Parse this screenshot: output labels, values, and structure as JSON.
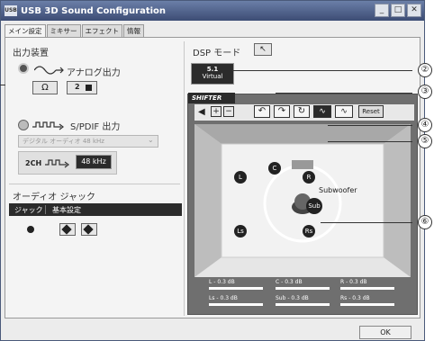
{
  "window": {
    "title": "USB 3D Sound Configuration",
    "app_icon": "USB"
  },
  "title_buttons": {
    "min": "_",
    "max": "□",
    "close": "✕"
  },
  "tabs": [
    {
      "label": "メイン設定"
    },
    {
      "label": "ミキサー"
    },
    {
      "label": "エフェクト"
    },
    {
      "label": "情報"
    }
  ],
  "output": {
    "header": "出力装置",
    "analog_label": "アナログ出力",
    "stereo_icon": "Ω",
    "mode_label": "2",
    "spdif_label": "S/PDIF 出力",
    "spdif_select": "デジタル オーディオ 48 kHz",
    "ch_label": "2CH",
    "rate_value": "48 kHz"
  },
  "jack": {
    "header": "オーディオ ジャック",
    "col1": "ジャック",
    "col2": "基本設定"
  },
  "dsp": {
    "header": "DSP モード",
    "virtual_label1": "5.1",
    "virtual_label2": "Virtual",
    "shifter_tab": "SHIFTER",
    "reset_label": "Reset"
  },
  "speakers": {
    "c": "C",
    "l": "L",
    "r": "R",
    "ls": "Ls",
    "rs": "Rs",
    "sub": "Sub",
    "subwoofer": "Subwoofer"
  },
  "levels": [
    {
      "ch": "L",
      "value": "- 0.3 dB"
    },
    {
      "ch": "C",
      "value": "- 0.3 dB"
    },
    {
      "ch": "R",
      "value": "- 0.3 dB"
    },
    {
      "ch": "Ls",
      "value": "- 0.3 dB"
    },
    {
      "ch": "Sub",
      "value": "- 0.3 dB"
    },
    {
      "ch": "Rs",
      "value": "- 0.3 dB"
    }
  ],
  "ok_label": "OK",
  "callouts": [
    "②",
    "③",
    "④",
    "⑤",
    "⑥"
  ]
}
